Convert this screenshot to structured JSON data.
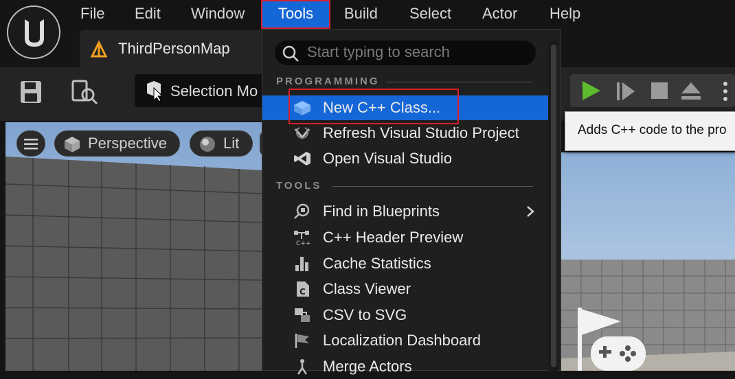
{
  "menubar": {
    "items": [
      "File",
      "Edit",
      "Window",
      "Tools",
      "Build",
      "Select",
      "Actor",
      "Help"
    ],
    "active": "Tools"
  },
  "tab": {
    "label": "ThirdPersonMap"
  },
  "toolbar": {
    "selection_mode_label": "Selection Mo"
  },
  "viewport": {
    "view_label": "Perspective",
    "lit_label": "Lit"
  },
  "tooltip": {
    "text": "Adds C++ code to the pro"
  },
  "dropdown": {
    "search_placeholder": "Start typing to search",
    "sections": [
      {
        "header": "PROGRAMMING",
        "items": [
          {
            "label": "New C++ Class...",
            "icon": "cpp-class-icon",
            "highlighted": true
          },
          {
            "label": "Refresh Visual Studio Project",
            "icon": "refresh-vs-icon"
          },
          {
            "label": "Open Visual Studio",
            "icon": "visual-studio-icon"
          }
        ]
      },
      {
        "header": "TOOLS",
        "items": [
          {
            "label": "Find in Blueprints",
            "icon": "find-blueprints-icon",
            "submenu": true
          },
          {
            "label": "C++ Header Preview",
            "icon": "cpp-header-icon"
          },
          {
            "label": "Cache Statistics",
            "icon": "bar-chart-icon"
          },
          {
            "label": "Class Viewer",
            "icon": "class-viewer-icon"
          },
          {
            "label": "CSV to SVG",
            "icon": "csv-svg-icon"
          },
          {
            "label": "Localization Dashboard",
            "icon": "flag-icon"
          },
          {
            "label": "Merge Actors",
            "icon": "merge-actors-icon"
          }
        ]
      }
    ]
  },
  "colors": {
    "accent": "#1566d6",
    "highlight_border": "#d9202a",
    "play_green": "#5dbb2e"
  }
}
